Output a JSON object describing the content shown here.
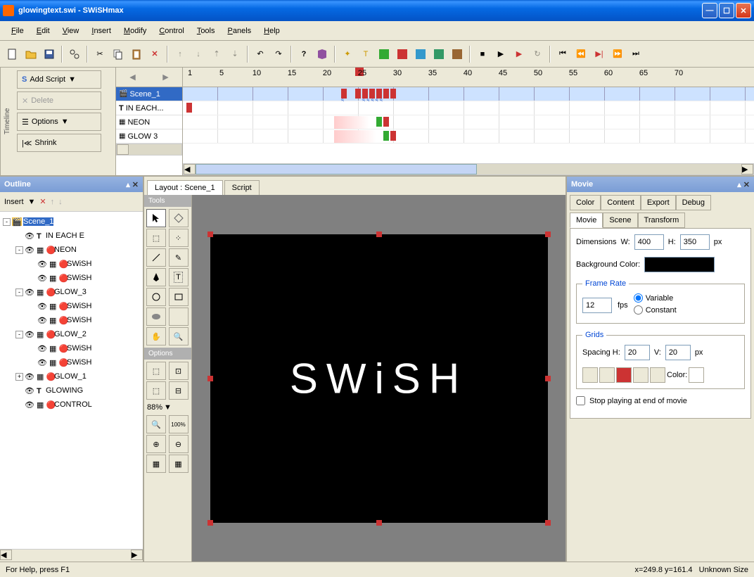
{
  "title": "glowingtext.swi - SWiSHmax",
  "menu": [
    "File",
    "Edit",
    "View",
    "Insert",
    "Modify",
    "Control",
    "Tools",
    "Panels",
    "Help"
  ],
  "timeline": {
    "add_script": "Add Script",
    "delete": "Delete",
    "options": "Options",
    "shrink": "Shrink",
    "tab": "Timeline",
    "tracks": [
      "Scene_1",
      "IN EACH...",
      "NEON",
      "GLOW 3"
    ],
    "ruler_marks": [
      1,
      5,
      10,
      15,
      20,
      25,
      30,
      35,
      40,
      45,
      50,
      55,
      60,
      65,
      70
    ],
    "playhead_frame": 25
  },
  "outline": {
    "title": "Outline",
    "insert": "Insert",
    "tree": [
      {
        "label": "Scene_1",
        "indent": 0,
        "selected": true,
        "expand": "-",
        "type": "scene"
      },
      {
        "label": "IN EACH E",
        "indent": 1,
        "type": "text"
      },
      {
        "label": "NEON",
        "indent": 1,
        "expand": "-",
        "type": "sprite"
      },
      {
        "label": "SWiSH",
        "indent": 2,
        "type": "sprite"
      },
      {
        "label": "SWiSH",
        "indent": 2,
        "type": "sprite"
      },
      {
        "label": "GLOW_3",
        "indent": 1,
        "expand": "-",
        "type": "sprite"
      },
      {
        "label": "SWiSH",
        "indent": 2,
        "type": "sprite"
      },
      {
        "label": "SWiSH",
        "indent": 2,
        "type": "sprite"
      },
      {
        "label": "GLOW_2",
        "indent": 1,
        "expand": "-",
        "type": "sprite"
      },
      {
        "label": "SWiSH",
        "indent": 2,
        "type": "sprite"
      },
      {
        "label": "SWiSH",
        "indent": 2,
        "type": "sprite"
      },
      {
        "label": "GLOW_1",
        "indent": 1,
        "expand": "+",
        "type": "sprite"
      },
      {
        "label": "GLOWING",
        "indent": 1,
        "type": "text"
      },
      {
        "label": "CONTROL",
        "indent": 1,
        "type": "sprite"
      }
    ]
  },
  "layout": {
    "tab_layout": "Layout : Scene_1",
    "tab_script": "Script",
    "tools_label": "Tools",
    "options_label": "Options",
    "zoom": "88%",
    "stage_text": "SWiSH"
  },
  "movie": {
    "title": "Movie",
    "tabs_top": [
      "Color",
      "Content",
      "Export",
      "Debug"
    ],
    "tabs_bottom": [
      "Movie",
      "Scene",
      "Transform"
    ],
    "active_tab": "Movie",
    "dimensions_label": "Dimensions",
    "w_label": "W:",
    "h_label": "H:",
    "width": "400",
    "height": "350",
    "px": "px",
    "bg_label": "Background Color:",
    "frame_rate_label": "Frame Rate",
    "fps_value": "12",
    "fps": "fps",
    "variable": "Variable",
    "constant": "Constant",
    "grids_label": "Grids",
    "spacing_h": "Spacing H:",
    "spacing_h_val": "20",
    "v_label": "V:",
    "spacing_v_val": "20",
    "color_label": "Color:",
    "stop_playing": "Stop playing at end of movie"
  },
  "status": {
    "help": "For Help, press F1",
    "coords": "x=249.8 y=161.4",
    "size": "Unknown Size"
  }
}
